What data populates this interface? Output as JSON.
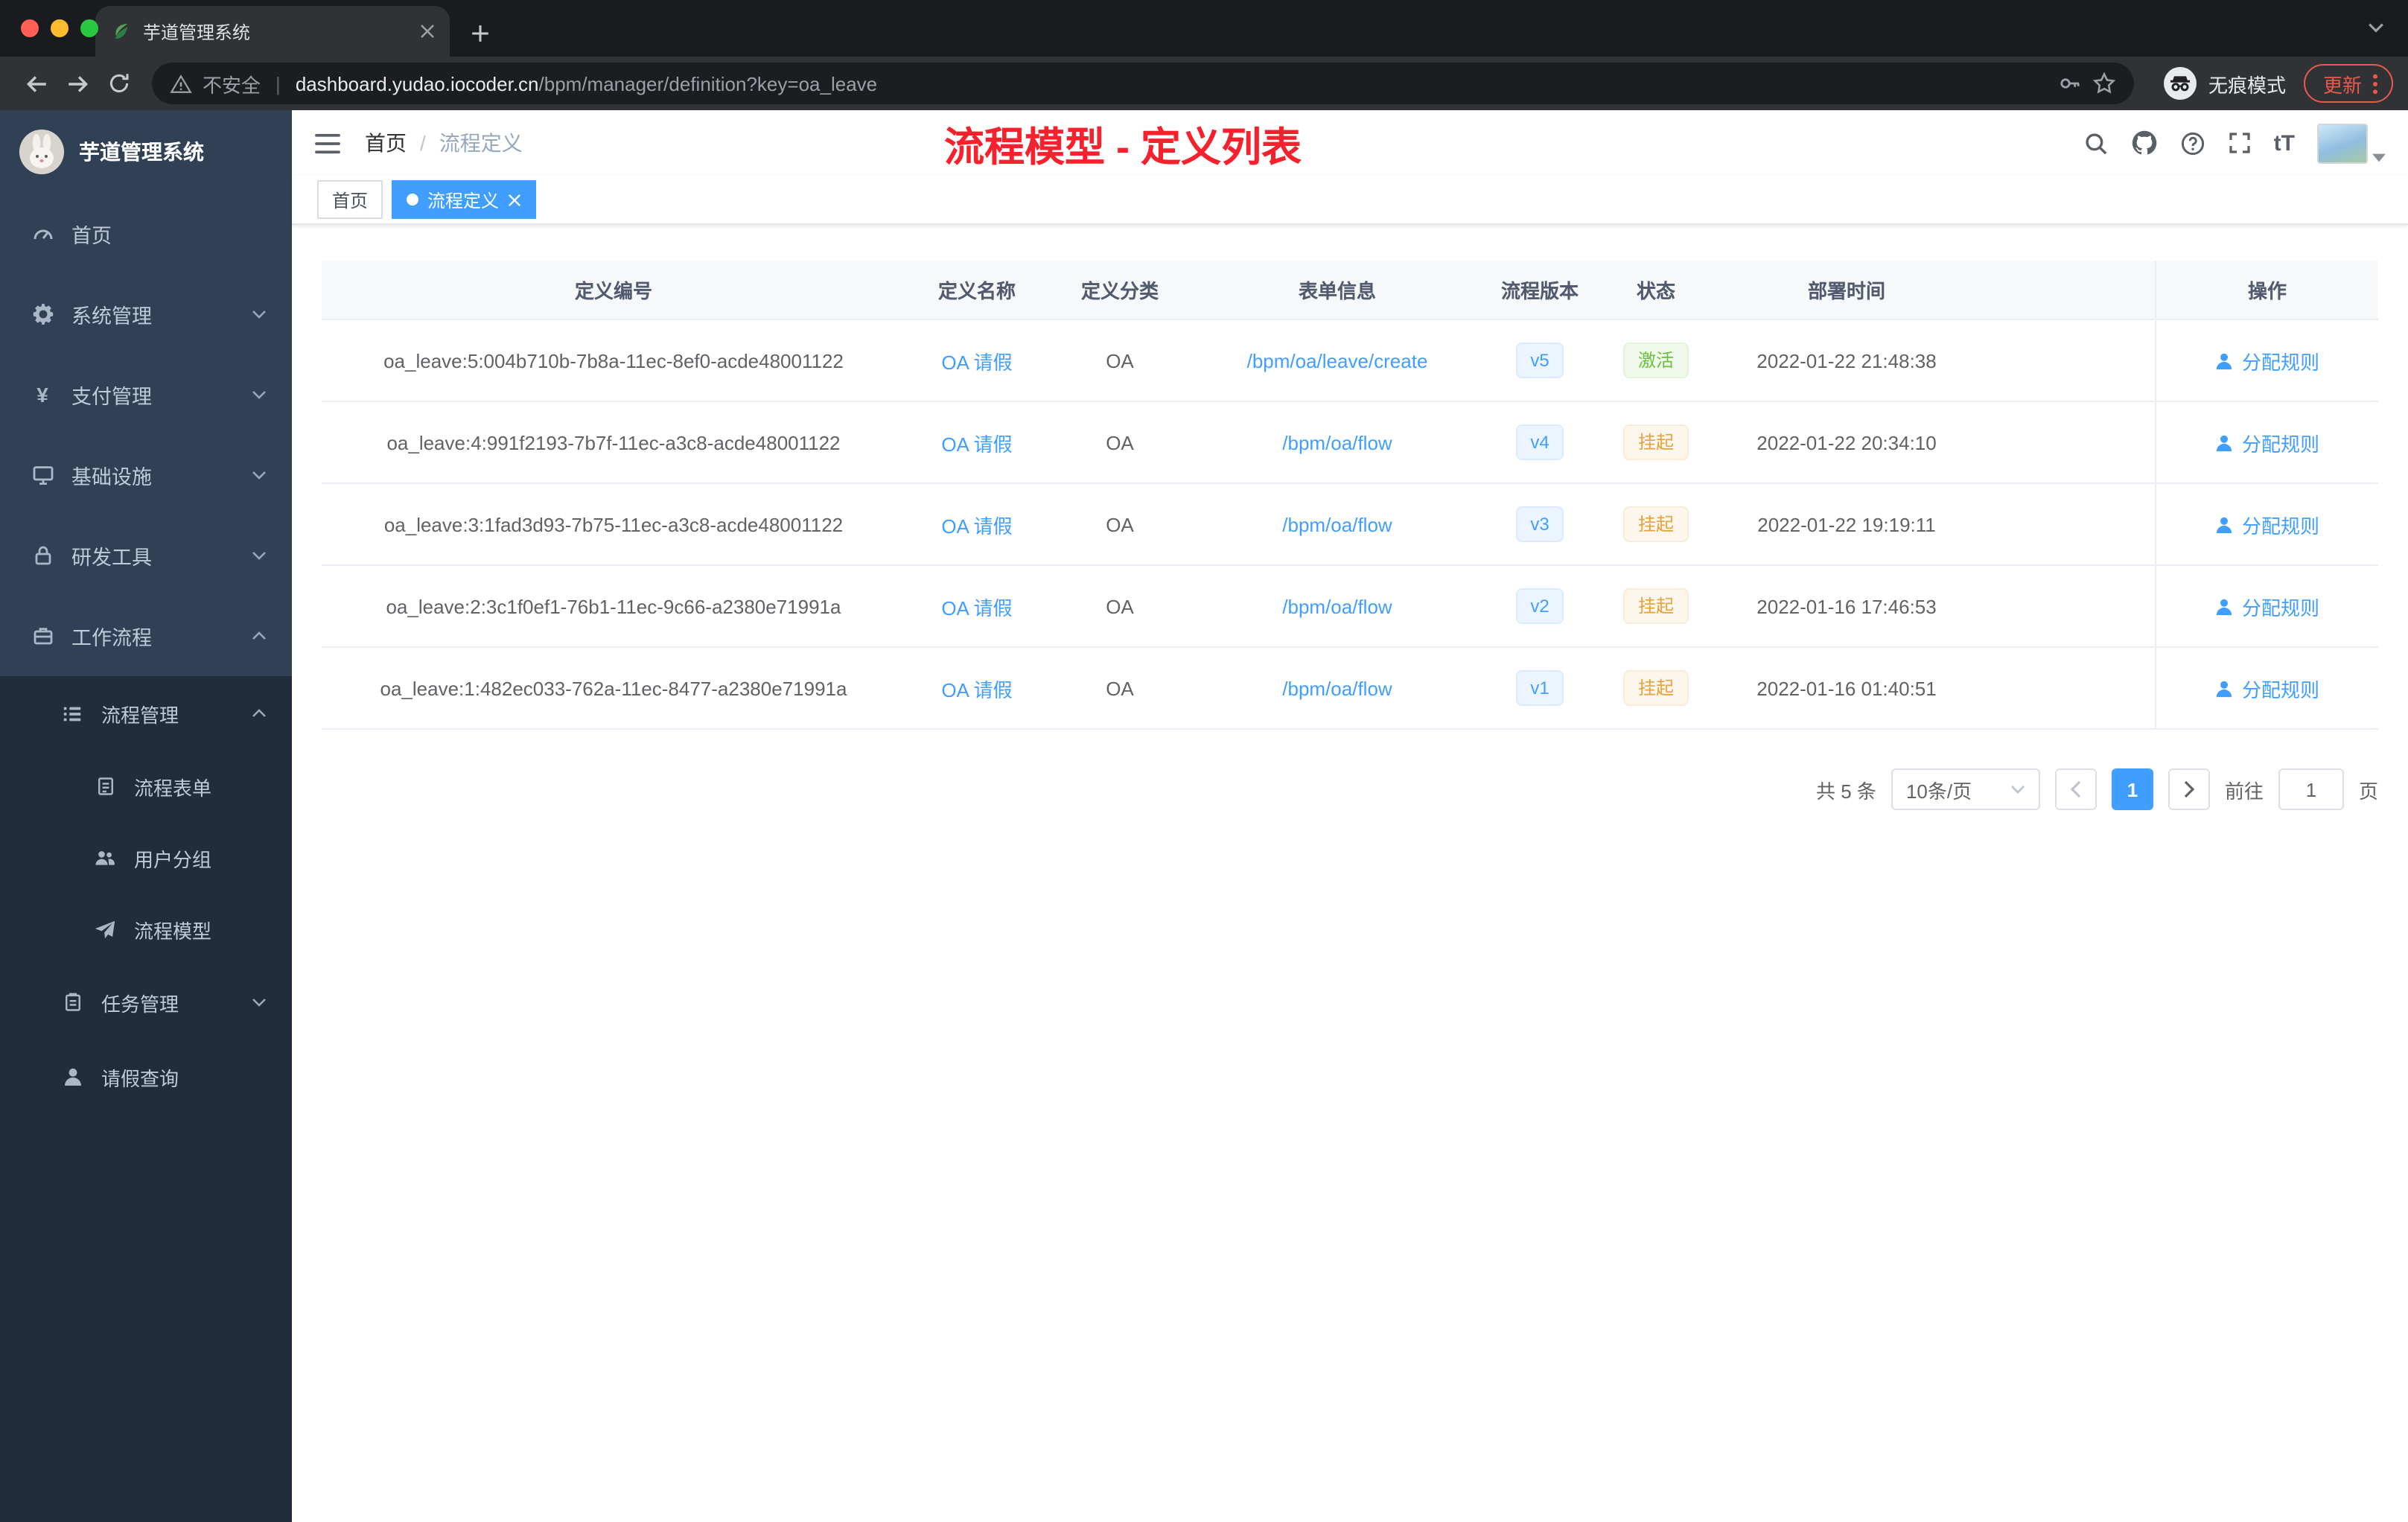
{
  "colors": {
    "accent": "#409eff",
    "success": "#67c23a",
    "warning": "#e6a23c",
    "annotation_red": "#f5222d",
    "sidebar_bg": "#304156",
    "submenu_bg": "#1f2d3d"
  },
  "browser": {
    "tab_title": "芋道管理系统",
    "security_label": "不安全",
    "url_domain": "dashboard.yudao.iocoder.cn",
    "url_path": "/bpm/manager/definition?key=oa_leave",
    "incognito_label": "无痕模式",
    "update_label": "更新"
  },
  "sidebar": {
    "brand": "芋道管理系统",
    "items": [
      {
        "label": "首页",
        "icon": "dashboard-icon",
        "level": 1
      },
      {
        "label": "系统管理",
        "icon": "gear-icon",
        "level": 1,
        "chevron": "down"
      },
      {
        "label": "支付管理",
        "icon": "yen-icon",
        "level": 1,
        "chevron": "down"
      },
      {
        "label": "基础设施",
        "icon": "monitor-icon",
        "level": 1,
        "chevron": "down"
      },
      {
        "label": "研发工具",
        "icon": "lock-icon",
        "level": 1,
        "chevron": "down"
      },
      {
        "label": "工作流程",
        "icon": "briefcase-icon",
        "level": 1,
        "chevron": "up"
      },
      {
        "label": "流程管理",
        "icon": "list-icon",
        "level": 2,
        "chevron": "up"
      },
      {
        "label": "流程表单",
        "icon": "document-icon",
        "level": 3
      },
      {
        "label": "用户分组",
        "icon": "people-icon",
        "level": 3
      },
      {
        "label": "流程模型",
        "icon": "send-icon",
        "level": 3
      },
      {
        "label": "任务管理",
        "icon": "clipboard-icon",
        "level": 2,
        "chevron": "down"
      },
      {
        "label": "请假查询",
        "icon": "person-icon",
        "level": 2
      }
    ],
    "yen_glyph": "¥"
  },
  "header": {
    "breadcrumb": {
      "home": "首页",
      "separator": "/",
      "current": "流程定义"
    },
    "annotation": "流程模型 - 定义列表",
    "font_icon_label": "tT",
    "icons": [
      "search-icon",
      "github-icon",
      "help-icon",
      "fullscreen-icon",
      "font-size-icon",
      "avatar"
    ]
  },
  "tags": [
    {
      "label": "首页",
      "active": false
    },
    {
      "label": "流程定义",
      "active": true
    }
  ],
  "table": {
    "headers": [
      "定义编号",
      "定义名称",
      "定义分类",
      "表单信息",
      "流程版本",
      "状态",
      "部署时间",
      "操作"
    ],
    "rows": [
      {
        "id": "oa_leave:5:004b710b-7b8a-11ec-8ef0-acde48001122",
        "name": "OA 请假",
        "category": "OA",
        "form": "/bpm/oa/leave/create",
        "version": "v5",
        "status": "激活",
        "status_type": "success",
        "time": "2022-01-22 21:48:38",
        "action": "分配规则"
      },
      {
        "id": "oa_leave:4:991f2193-7b7f-11ec-a3c8-acde48001122",
        "name": "OA 请假",
        "category": "OA",
        "form": "/bpm/oa/flow",
        "version": "v4",
        "status": "挂起",
        "status_type": "warning",
        "time": "2022-01-22 20:34:10",
        "action": "分配规则"
      },
      {
        "id": "oa_leave:3:1fad3d93-7b75-11ec-a3c8-acde48001122",
        "name": "OA 请假",
        "category": "OA",
        "form": "/bpm/oa/flow",
        "version": "v3",
        "status": "挂起",
        "status_type": "warning",
        "time": "2022-01-22 19:19:11",
        "action": "分配规则"
      },
      {
        "id": "oa_leave:2:3c1f0ef1-76b1-11ec-9c66-a2380e71991a",
        "name": "OA 请假",
        "category": "OA",
        "form": "/bpm/oa/flow",
        "version": "v2",
        "status": "挂起",
        "status_type": "warning",
        "time": "2022-01-16 17:46:53",
        "action": "分配规则"
      },
      {
        "id": "oa_leave:1:482ec033-762a-11ec-8477-a2380e71991a",
        "name": "OA 请假",
        "category": "OA",
        "form": "/bpm/oa/flow",
        "version": "v1",
        "status": "挂起",
        "status_type": "warning",
        "time": "2022-01-16 01:40:51",
        "action": "分配规则"
      }
    ]
  },
  "pagination": {
    "total": "共 5 条",
    "page_size": "10条/页",
    "current_page": "1",
    "goto_label": "前往",
    "goto_value": "1",
    "goto_suffix": "页"
  }
}
